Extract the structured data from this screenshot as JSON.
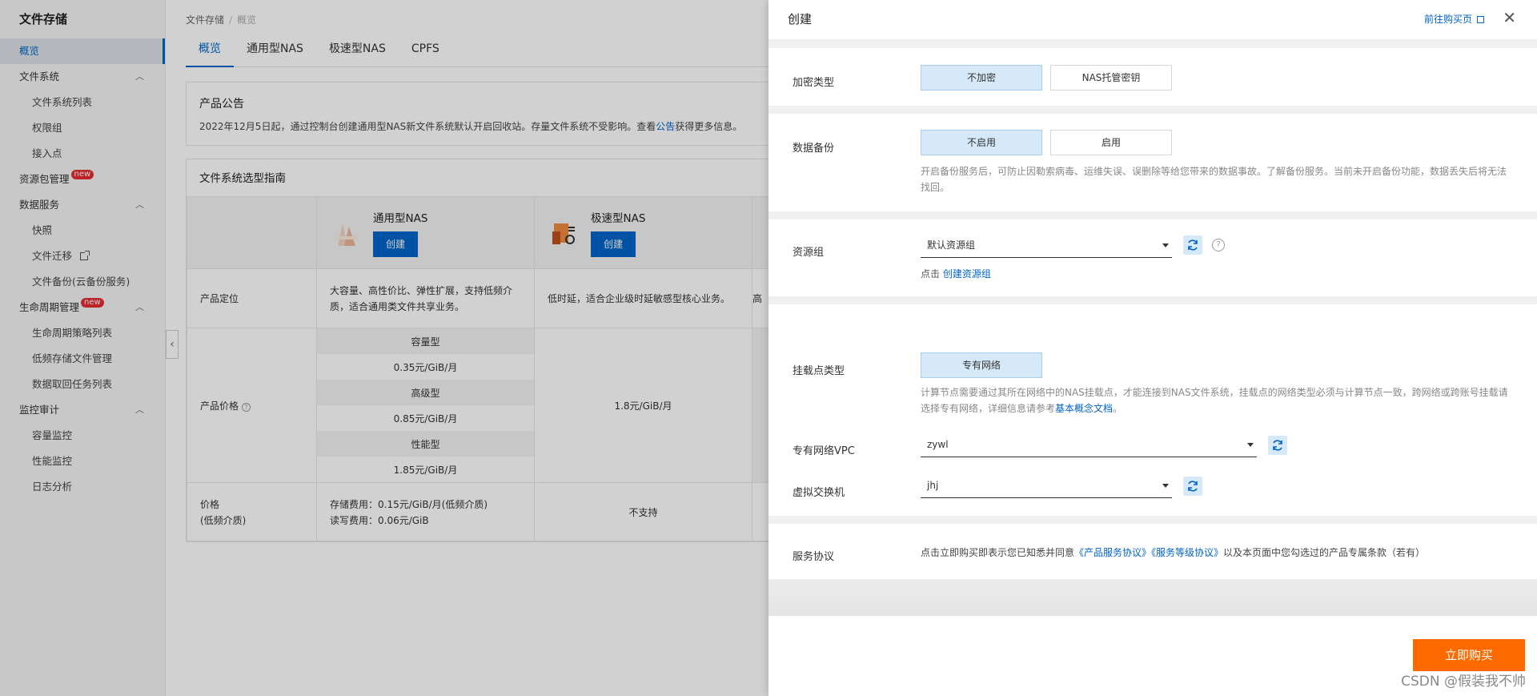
{
  "sidebar": {
    "title": "文件存储",
    "items": [
      {
        "label": "概览",
        "level": 0,
        "active": true
      },
      {
        "label": "文件系统",
        "level": 0,
        "chevron": "︿"
      },
      {
        "label": "文件系统列表",
        "level": 1
      },
      {
        "label": "权限组",
        "level": 1
      },
      {
        "label": "接入点",
        "level": 1
      },
      {
        "label": "资源包管理",
        "level": 0,
        "badge": "new"
      },
      {
        "label": "数据服务",
        "level": 0,
        "chevron": "︿"
      },
      {
        "label": "快照",
        "level": 1
      },
      {
        "label": "文件迁移",
        "level": 1,
        "external": true
      },
      {
        "label": "文件备份(云备份服务)",
        "level": 1
      },
      {
        "label": "生命周期管理",
        "level": 0,
        "badge": "new",
        "chevron": "︿"
      },
      {
        "label": "生命周期策略列表",
        "level": 1
      },
      {
        "label": "低频存储文件管理",
        "level": 1
      },
      {
        "label": "数据取回任务列表",
        "level": 1
      },
      {
        "label": "监控审计",
        "level": 0,
        "chevron": "︿"
      },
      {
        "label": "容量监控",
        "level": 1
      },
      {
        "label": "性能监控",
        "level": 1
      },
      {
        "label": "日志分析",
        "level": 1
      }
    ]
  },
  "breadcrumb": {
    "root": "文件存储",
    "sep": "/",
    "current": "概览"
  },
  "tabs": [
    "概览",
    "通用型NAS",
    "极速型NAS",
    "CPFS"
  ],
  "notice": {
    "title": "产品公告",
    "text_before": "2022年12月5日起，通过控制台创建通用型NAS新文件系统默认开启回收站。存量文件系统不受影响。查看",
    "link": "公告",
    "text_after": "获得更多信息。"
  },
  "guide": {
    "title": "文件系统选型指南",
    "products": [
      {
        "name": "通用型NAS",
        "button": "创建"
      },
      {
        "name": "极速型NAS",
        "button": "创建"
      }
    ],
    "row_position": {
      "label": "产品定位",
      "general": "大容量、高性价比、弹性扩展，支持低频介质，适合通用类文件共享业务。",
      "extreme": "低时延，适合企业级时延敏感型核心业务。",
      "third": "高"
    },
    "row_price": {
      "label": "产品价格",
      "help": "?",
      "general": [
        "容量型",
        "0.35元/GiB/月",
        "高级型",
        "0.85元/GiB/月",
        "性能型",
        "1.85元/GiB/月"
      ],
      "extreme": "1.8元/GiB/月"
    },
    "row_fee": {
      "label_1": "价格",
      "label_2": "(低频介质)",
      "general_1": "存储费用：0.15元/GiB/月(低频介质)",
      "general_2": "读写费用：0.06元/GiB",
      "extreme": "不支持"
    }
  },
  "drawer": {
    "title": "创建",
    "buy_link": "前往购买页",
    "close": "✕",
    "encryption": {
      "label": "加密类型",
      "options": [
        "不加密",
        "NAS托管密钥"
      ],
      "selected": 0
    },
    "backup": {
      "label": "数据备份",
      "options": [
        "不启用",
        "启用"
      ],
      "selected": 0,
      "hint_1": "开启备份服务后，可防止因勒索病毒、运维失误、误删除等给您带来的数据事故。了解备份服务。当前未开启备份功能，数据丢失后将无法",
      "hint_2": "找回。"
    },
    "resource_group": {
      "label": "资源组",
      "value": "默认资源组",
      "help": "?",
      "hint_prefix": "点击",
      "hint_link": "创建资源组"
    },
    "mount": {
      "label": "挂载点类型",
      "option": "专有网络",
      "hint_1": "计算节点需要通过其所在网络中的NAS挂载点，才能连接到NAS文件系统，挂载点的网络类型必须与计算节点一致，跨网络或跨账号挂载请",
      "hint_2_before": "选择专有网络，详细信息请参考",
      "hint_2_link": "基本概念文档",
      "hint_2_after": "。"
    },
    "vpc": {
      "label": "专有网络VPC",
      "value": "zywl"
    },
    "vswitch": {
      "label": "虚拟交换机",
      "value": "jhj"
    },
    "agreement": {
      "label": "服务协议",
      "text_before": "点击立即购买即表示您已知悉并同意",
      "link1": "《产品服务协议》",
      "link2": "《服务等级协议》",
      "text_after": "以及本页面中您勾选过的产品专属条款（若有）"
    },
    "buy_button": "立即购买"
  },
  "watermark": "CSDN @假装我不帅",
  "colors": {
    "primary": "#0064c8",
    "buy": "#ff6a00",
    "selected_bg": "#d6e9f8",
    "badge": "#e62d32"
  }
}
